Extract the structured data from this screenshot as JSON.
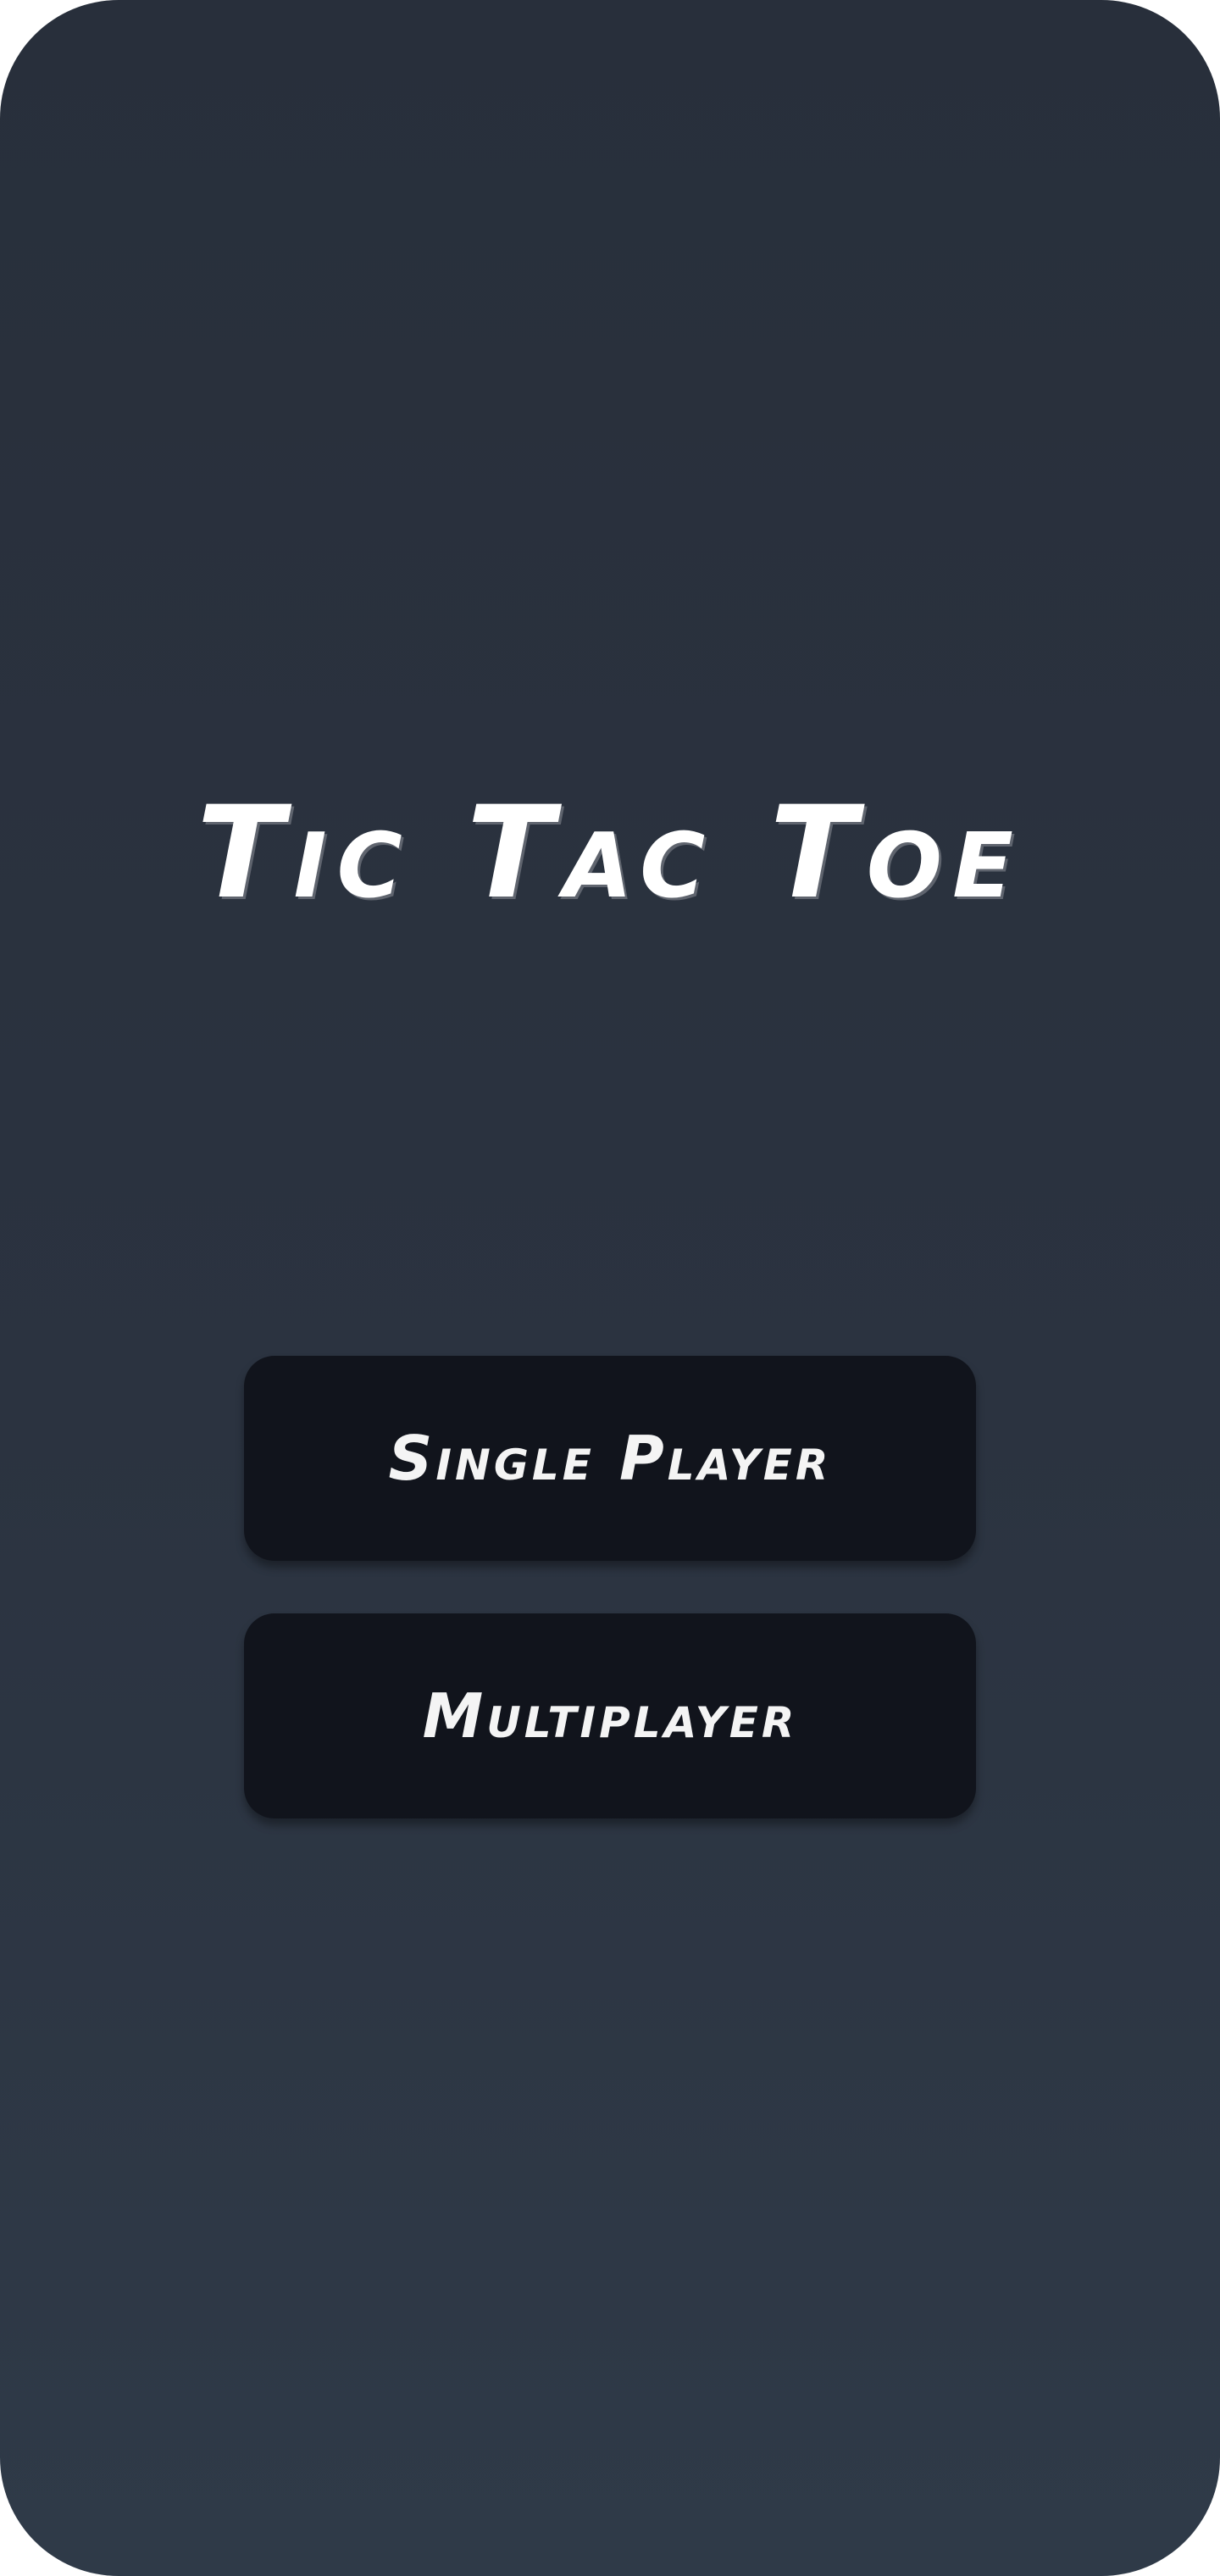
{
  "game": {
    "title": "Tic Tac Toe"
  },
  "menu": {
    "single_player_label": "Single Player",
    "multiplayer_label": "Multiplayer"
  },
  "colors": {
    "background": "#2b3340",
    "button": "#11141c",
    "text": "#ffffff"
  }
}
